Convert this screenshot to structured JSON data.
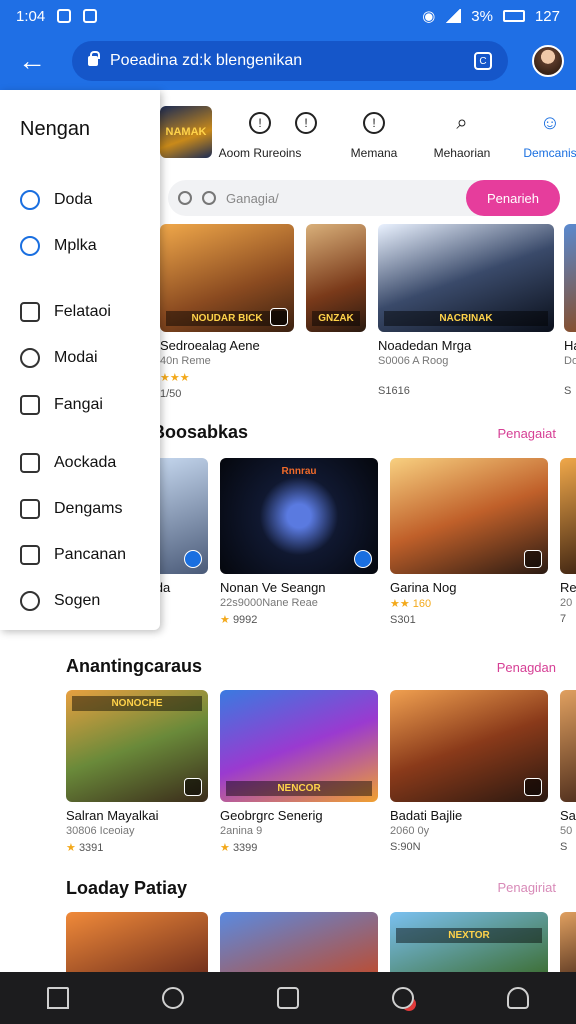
{
  "status_bar": {
    "time": "1:04",
    "battery": "127",
    "signal_pct": "3%"
  },
  "app_bar": {
    "url": "Poeadina zd:k blengenikan",
    "tab_glyph": "C"
  },
  "drawer": {
    "title": "Nengan",
    "items": [
      {
        "label": "Doda",
        "icon": "star-icon"
      },
      {
        "label": "Mplka",
        "icon": "clock-icon"
      },
      {
        "label": "Felataoi",
        "icon": "pin-icon"
      },
      {
        "label": "Modai",
        "icon": "smile-icon"
      },
      {
        "label": "Fangai",
        "icon": "chat-icon"
      },
      {
        "label": "Aockada",
        "icon": "gauge-icon"
      },
      {
        "label": "Dengams",
        "icon": "folder-icon"
      },
      {
        "label": "Pancanan",
        "icon": "square-icon"
      },
      {
        "label": "Sogen",
        "icon": "gear-icon"
      }
    ]
  },
  "categories": {
    "logo_text": "NAMAK",
    "items": [
      {
        "label": "Aoom Rureoins",
        "glyph": "!"
      },
      {
        "label": "",
        "glyph": "!"
      },
      {
        "label": "Memana",
        "glyph": "!"
      },
      {
        "label": "Mehaorian",
        "glyph": "⌕"
      },
      {
        "label": "Demcanis",
        "glyph": "☺"
      }
    ]
  },
  "search": {
    "placeholder": "Ganagia/",
    "button": "Penarieh"
  },
  "row1": [
    {
      "title": "Sedroealag Aene",
      "sub": "40n Reme",
      "meta": "1/50",
      "thumb": "NOUDAR BICK",
      "stars": "★★★"
    },
    {
      "title": "",
      "sub": "",
      "meta": "",
      "thumb": "GNZAK",
      "stars": ""
    },
    {
      "title": "Noadedan Mrga",
      "sub": "S0006 A Roog",
      "meta": "S1616",
      "thumb": "NACRINAK",
      "stars": ""
    },
    {
      "title": "Ha",
      "sub": "Do",
      "meta": "S",
      "thumb": "",
      "stars": ""
    }
  ],
  "section1": {
    "title": "Boosabkas",
    "more": "Penagaiat"
  },
  "row2": [
    {
      "title": "iida",
      "sub": "'a",
      "meta": "",
      "thumb": "",
      "stars": ""
    },
    {
      "title": "Nonan Ve Seangn",
      "sub": "22s9000Nane Reae",
      "meta": "9992",
      "thumb": "Rnnrau",
      "stars": "★"
    },
    {
      "title": "Garina Nog",
      "sub": "",
      "meta": "S301",
      "thumb": "",
      "stars": "★★ 160"
    },
    {
      "title": "Re",
      "sub": "20",
      "meta": "7",
      "thumb": "",
      "stars": ""
    }
  ],
  "section2": {
    "title": "Anantingcaraus",
    "more": "Penagdan"
  },
  "row3": [
    {
      "title": "Salran Mayalkai",
      "sub": "30806 Iceoiay",
      "meta": "3391",
      "thumb": "NONOCHE",
      "stars": "★"
    },
    {
      "title": "Geobrgrc Senerig",
      "sub": "2anina 9",
      "meta": "3399",
      "thumb": "NENCOR",
      "stars": "★"
    },
    {
      "title": "Badati Bajlie",
      "sub": "2060 0y",
      "meta": "S:90N",
      "thumb": "",
      "stars": ""
    },
    {
      "title": "Sa",
      "sub": "50",
      "meta": "S",
      "thumb": "",
      "stars": ""
    }
  ],
  "section3": {
    "title": "Loaday Patiay",
    "more": "Penagiriat"
  },
  "row4": [
    {
      "thumb": ""
    },
    {
      "thumb": ""
    },
    {
      "thumb": "NEXTOR"
    },
    {
      "thumb": ""
    }
  ],
  "colors": {
    "primary": "#1f6fe5",
    "accent": "#e63d9c",
    "link": "#d63f95"
  }
}
